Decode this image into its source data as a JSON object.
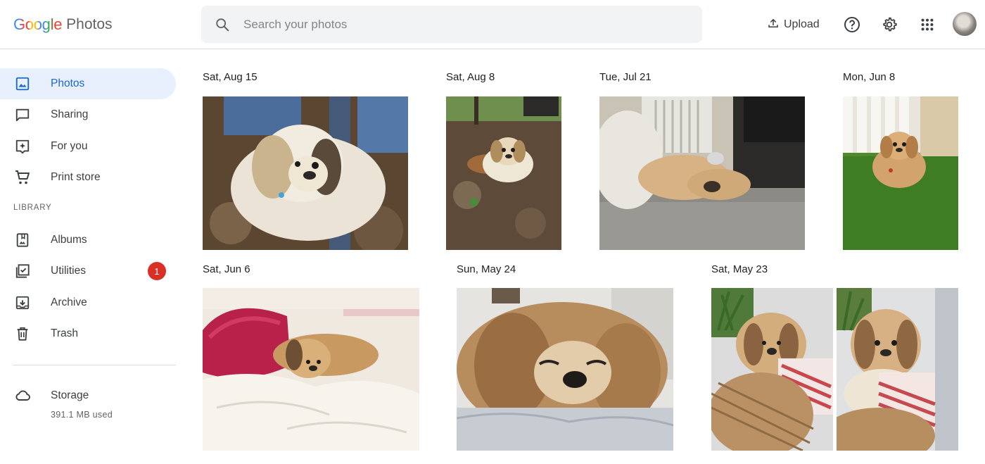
{
  "app": {
    "logo_word": "Google",
    "logo_product": "Photos"
  },
  "search": {
    "placeholder": "Search your photos"
  },
  "header": {
    "upload_label": "Upload"
  },
  "sidebar": {
    "items": [
      {
        "label": "Photos",
        "active": true
      },
      {
        "label": "Sharing"
      },
      {
        "label": "For you"
      },
      {
        "label": "Print store"
      }
    ],
    "library_label": "LIBRARY",
    "library_items": [
      {
        "label": "Albums"
      },
      {
        "label": "Utilities",
        "badge": "1"
      },
      {
        "label": "Archive"
      },
      {
        "label": "Trash"
      }
    ],
    "storage": {
      "label": "Storage",
      "used": "391.1 MB used"
    }
  },
  "groups": [
    {
      "date": "Sat, Aug 15"
    },
    {
      "date": "Sat, Aug 8"
    },
    {
      "date": "Tue, Jul 21"
    },
    {
      "date": "Mon, Jun 8"
    },
    {
      "date": "Sat, Jun 6"
    },
    {
      "date": "Sun, May 24"
    },
    {
      "date": "Sat, May 23"
    }
  ],
  "colors": {
    "accent": "#1967d2",
    "active_bg": "#e8f0fe",
    "badge": "#d93025"
  }
}
